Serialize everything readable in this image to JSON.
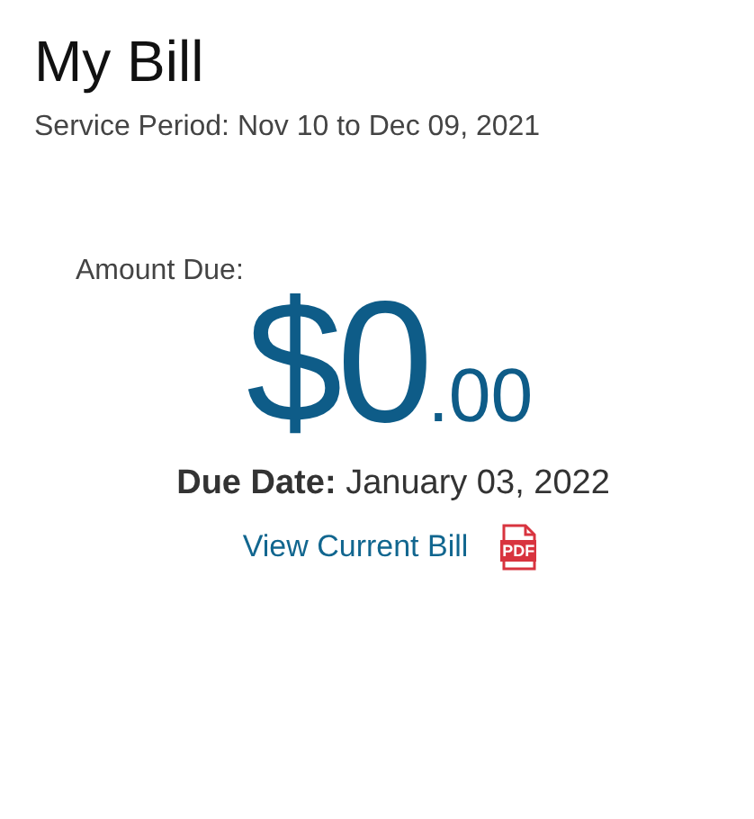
{
  "title": "My Bill",
  "service_period": "Service Period: Nov 10 to Dec 09, 2021",
  "amount_due": {
    "label": "Amount Due:",
    "dollars": "$0",
    "cents": ".00"
  },
  "due_date": {
    "label": "Due Date:",
    "value": "January 03, 2022"
  },
  "view_bill": {
    "label": "View Current Bill",
    "icon_label": "PDF"
  }
}
